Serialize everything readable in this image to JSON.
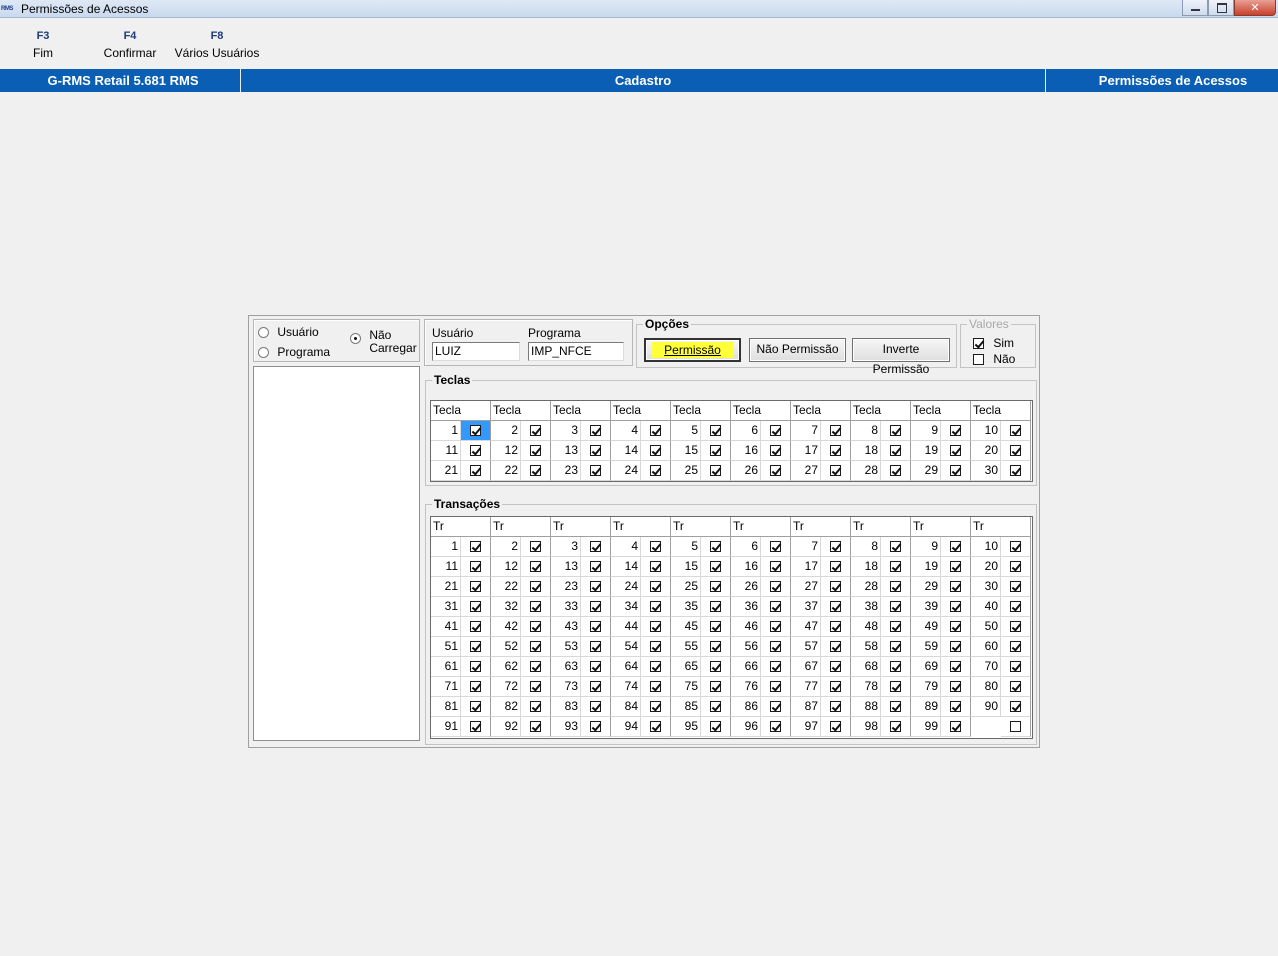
{
  "window": {
    "title": "Permissões de Acessos",
    "logo_text": "RMS"
  },
  "fkeys": [
    {
      "key": "F3",
      "label": "Fim"
    },
    {
      "key": "F4",
      "label": "Confirmar"
    },
    {
      "key": "F8",
      "label": "Vários Usuários"
    }
  ],
  "header": {
    "left": "G-RMS Retail 5.681 RMS",
    "center": "Cadastro",
    "right": "Permissões de Acessos"
  },
  "load_mode": {
    "options": [
      "Usuário",
      "Programa",
      "Não Carregar"
    ],
    "selected": "Não Carregar"
  },
  "fields": {
    "usuario_label": "Usuário",
    "usuario_value": "LUIZ",
    "programa_label": "Programa",
    "programa_value": "IMP_NFCE"
  },
  "opcoes": {
    "title": "Opções",
    "permissao": "Permissão",
    "nao_permissao": "Não Permissão",
    "inverte_permissao": "Inverte Permissão"
  },
  "valores": {
    "title": "Valores",
    "sim": "Sim",
    "nao": "Não",
    "sim_checked": true,
    "nao_checked": false
  },
  "teclas": {
    "title": "Teclas",
    "column_header": "Tecla",
    "columns": 10,
    "rows": 3,
    "selected_cell": 1,
    "unchecked": []
  },
  "transacoes": {
    "title": "Transações",
    "column_header": "Tr",
    "columns": 10,
    "rows": 10,
    "total": 99,
    "unchecked": []
  }
}
